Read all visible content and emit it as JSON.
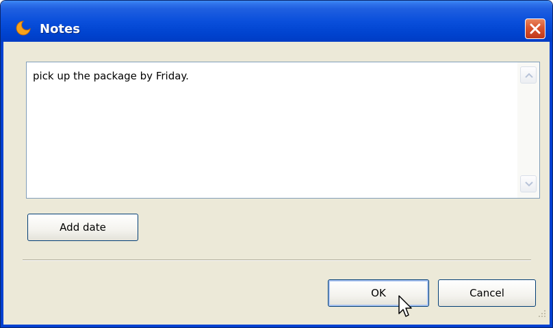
{
  "window": {
    "title": "Notes",
    "app_icon": "orange-crescent-app-icon",
    "close_icon": "close-x-icon"
  },
  "note": {
    "value": "pick up the package by Friday."
  },
  "buttons": {
    "add_date": "Add date",
    "ok": "OK",
    "cancel": "Cancel"
  },
  "colors": {
    "titlebar": "#0a4fdb",
    "close_button": "#d9542e",
    "dialog_background": "#ece9d8",
    "textarea_border": "#7f9db9"
  }
}
